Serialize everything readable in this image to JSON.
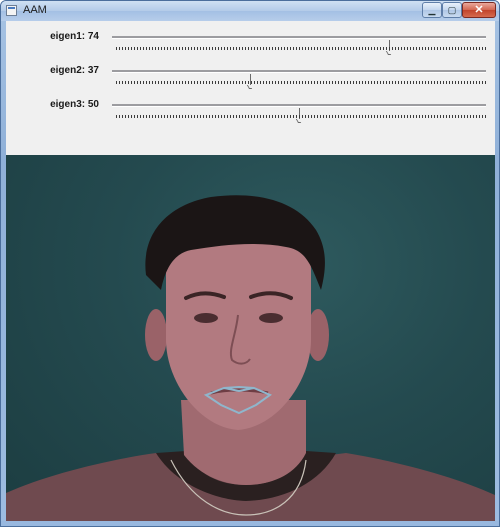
{
  "window": {
    "title": "AAM"
  },
  "trackbars": [
    {
      "label": "eigen1: 74",
      "value": 74,
      "max": 100
    },
    {
      "label": "eigen2: 37",
      "value": 37,
      "max": 100
    },
    {
      "label": "eigen3: 50",
      "value": 50,
      "max": 100
    }
  ],
  "colors": {
    "background": "#1f4347",
    "landmark_line": "#8fb6cc",
    "controls_background": "#f0f0f0"
  },
  "icons": {
    "app": "window-app-icon",
    "minimize": "minimize-icon",
    "maximize": "maximize-icon",
    "close": "close-icon"
  }
}
